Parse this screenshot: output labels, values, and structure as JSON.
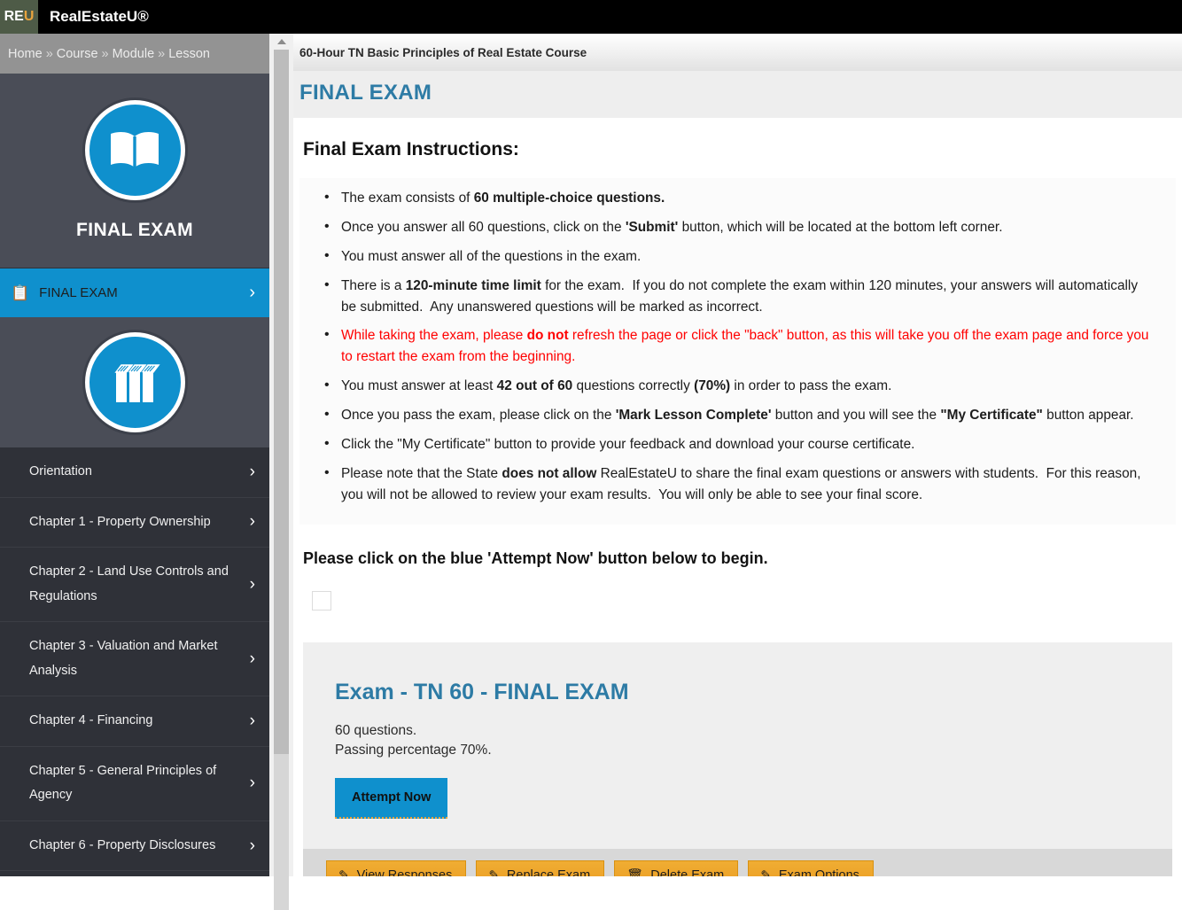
{
  "topbar": {
    "logo_initials_primary": "RE",
    "logo_initials_accent": "U",
    "brand": "RealEstateU®"
  },
  "sidebar": {
    "breadcrumb": [
      {
        "label": "Home"
      },
      {
        "label": "Course"
      },
      {
        "label": "Module"
      },
      {
        "label": "Lesson"
      }
    ],
    "breadcrumb_separator": "»",
    "hero_title": "FINAL EXAM",
    "hero_icon": "open-book-icon",
    "active_lesson": {
      "icon": "clipboard-icon",
      "label": "FINAL EXAM",
      "chevron": "›"
    },
    "module_icon": "books-icon",
    "nav_items": [
      {
        "label": "Orientation",
        "chevron": "›"
      },
      {
        "label": "Chapter 1 - Property Ownership",
        "chevron": "›"
      },
      {
        "label": "Chapter 2 - Land Use Controls and Regulations",
        "chevron": "›"
      },
      {
        "label": "Chapter 3 - Valuation and Market Analysis",
        "chevron": "›"
      },
      {
        "label": "Chapter 4 - Financing",
        "chevron": "›"
      },
      {
        "label": "Chapter 5 - General Principles of Agency",
        "chevron": "›"
      },
      {
        "label": "Chapter 6 - Property Disclosures",
        "chevron": "›"
      }
    ]
  },
  "main": {
    "course_title": "60-Hour TN Basic Principles of Real Estate Course",
    "page_title": "FINAL EXAM",
    "instructions_heading": "Final Exam Instructions:",
    "instructions": [
      {
        "html": "The exam consists of <b>60 multiple-choice questions.</b>",
        "warn": false
      },
      {
        "html": "Once you answer all 60 questions, click on the <b>'Submit'</b> button, which will be located at the bottom left corner.",
        "warn": false
      },
      {
        "html": "You must answer all of the questions in the exam.",
        "warn": false
      },
      {
        "html": "There is a <b>120-minute time limit</b> for the exam.&nbsp; If you do not complete the exam within 120 minutes, your answers will automatically be submitted.&nbsp; Any unanswered questions will be marked as incorrect.",
        "warn": false
      },
      {
        "html": "While taking the exam, please <b>do not</b> refresh the page or click the \"back\" button, as this will take you off the exam page and force you to restart the exam from the beginning.",
        "warn": true
      },
      {
        "html": "You must answer at least <b>42 out of 60</b> questions correctly <b>(70%)</b> in order to pass the exam.",
        "warn": false
      },
      {
        "html": "Once you pass the exam, please click on the <b>'Mark Lesson Complete'</b> button and you will see the <b>\"My Certificate\"</b> button appear.",
        "warn": false
      },
      {
        "html": "Click the \"My Certificate\" button to provide your feedback and download your course certificate.",
        "warn": false
      },
      {
        "html": "Please note that the State <b>does not allow</b> RealEstateU to share the final exam questions or answers with students.&nbsp; For this reason, you will not be allowed to review your exam results.&nbsp; You will only be able to see your final score.",
        "warn": false
      }
    ],
    "begin_note": "Please click on the blue 'Attempt Now' button below to begin.",
    "exam_card": {
      "title": "Exam - TN 60 - FINAL EXAM",
      "question_count_text": "60 questions.",
      "passing_text": "Passing percentage 70%.",
      "attempt_button": "Attempt Now"
    },
    "actions": [
      {
        "icon": "edit-icon",
        "glyph": "✎",
        "label": "View Responses"
      },
      {
        "icon": "edit-icon",
        "glyph": "✎",
        "label": "Replace Exam"
      },
      {
        "icon": "trash-icon",
        "glyph": "Ὕ1",
        "label": "Delete Exam"
      },
      {
        "icon": "edit-icon",
        "glyph": "✎",
        "label": "Exam Options"
      }
    ]
  },
  "colors": {
    "brand_black": "#000000",
    "logo_green": "#4e5b47",
    "logo_accent_orange": "#e8a33d",
    "accent_blue": "#0f90cd",
    "title_blue": "#2d7ba5",
    "sidebar_dark": "#2f3138",
    "sidebar_hero": "#4a4d57",
    "breadcrumb_gray": "#939393",
    "warning_red": "#ff0000",
    "action_orange": "#eda42a",
    "card_gray": "#efefef",
    "footer_gray": "#d8d8d8"
  }
}
